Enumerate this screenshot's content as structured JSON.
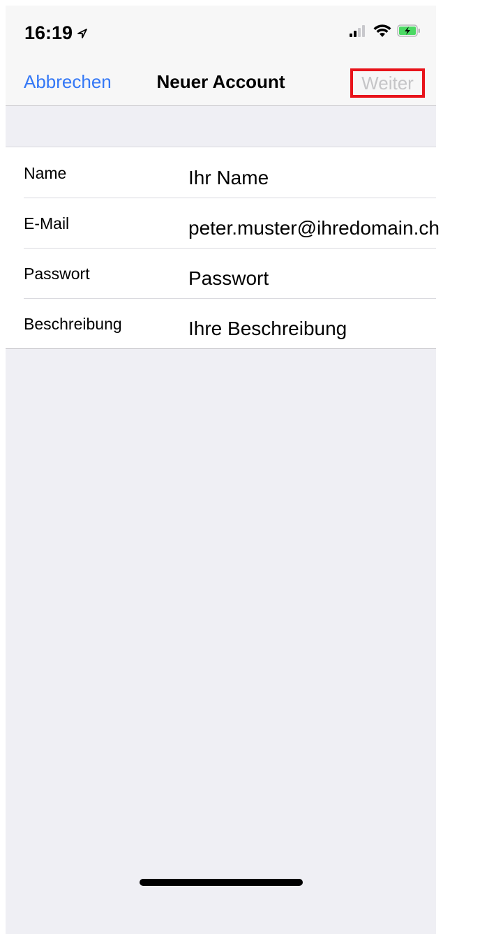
{
  "status_bar": {
    "time": "16:19",
    "location_icon": "location-arrow-icon",
    "signal_icon": "cellular-signal-icon",
    "wifi_icon": "wifi-icon",
    "battery_icon": "battery-charging-icon",
    "battery_color": "#4cd964"
  },
  "nav": {
    "cancel_label": "Abbrechen",
    "title": "Neuer Account",
    "next_label": "Weiter",
    "accent_color": "#3478f6",
    "highlight_color": "#e8141b"
  },
  "form": {
    "rows": [
      {
        "label": "Name",
        "value": "Ihr Name"
      },
      {
        "label": "E-Mail",
        "value": "peter.muster@ihredomain.ch"
      },
      {
        "label": "Passwort",
        "value": "Passwort"
      },
      {
        "label": "Beschreibung",
        "value": "Ihre Beschreibung"
      }
    ]
  }
}
